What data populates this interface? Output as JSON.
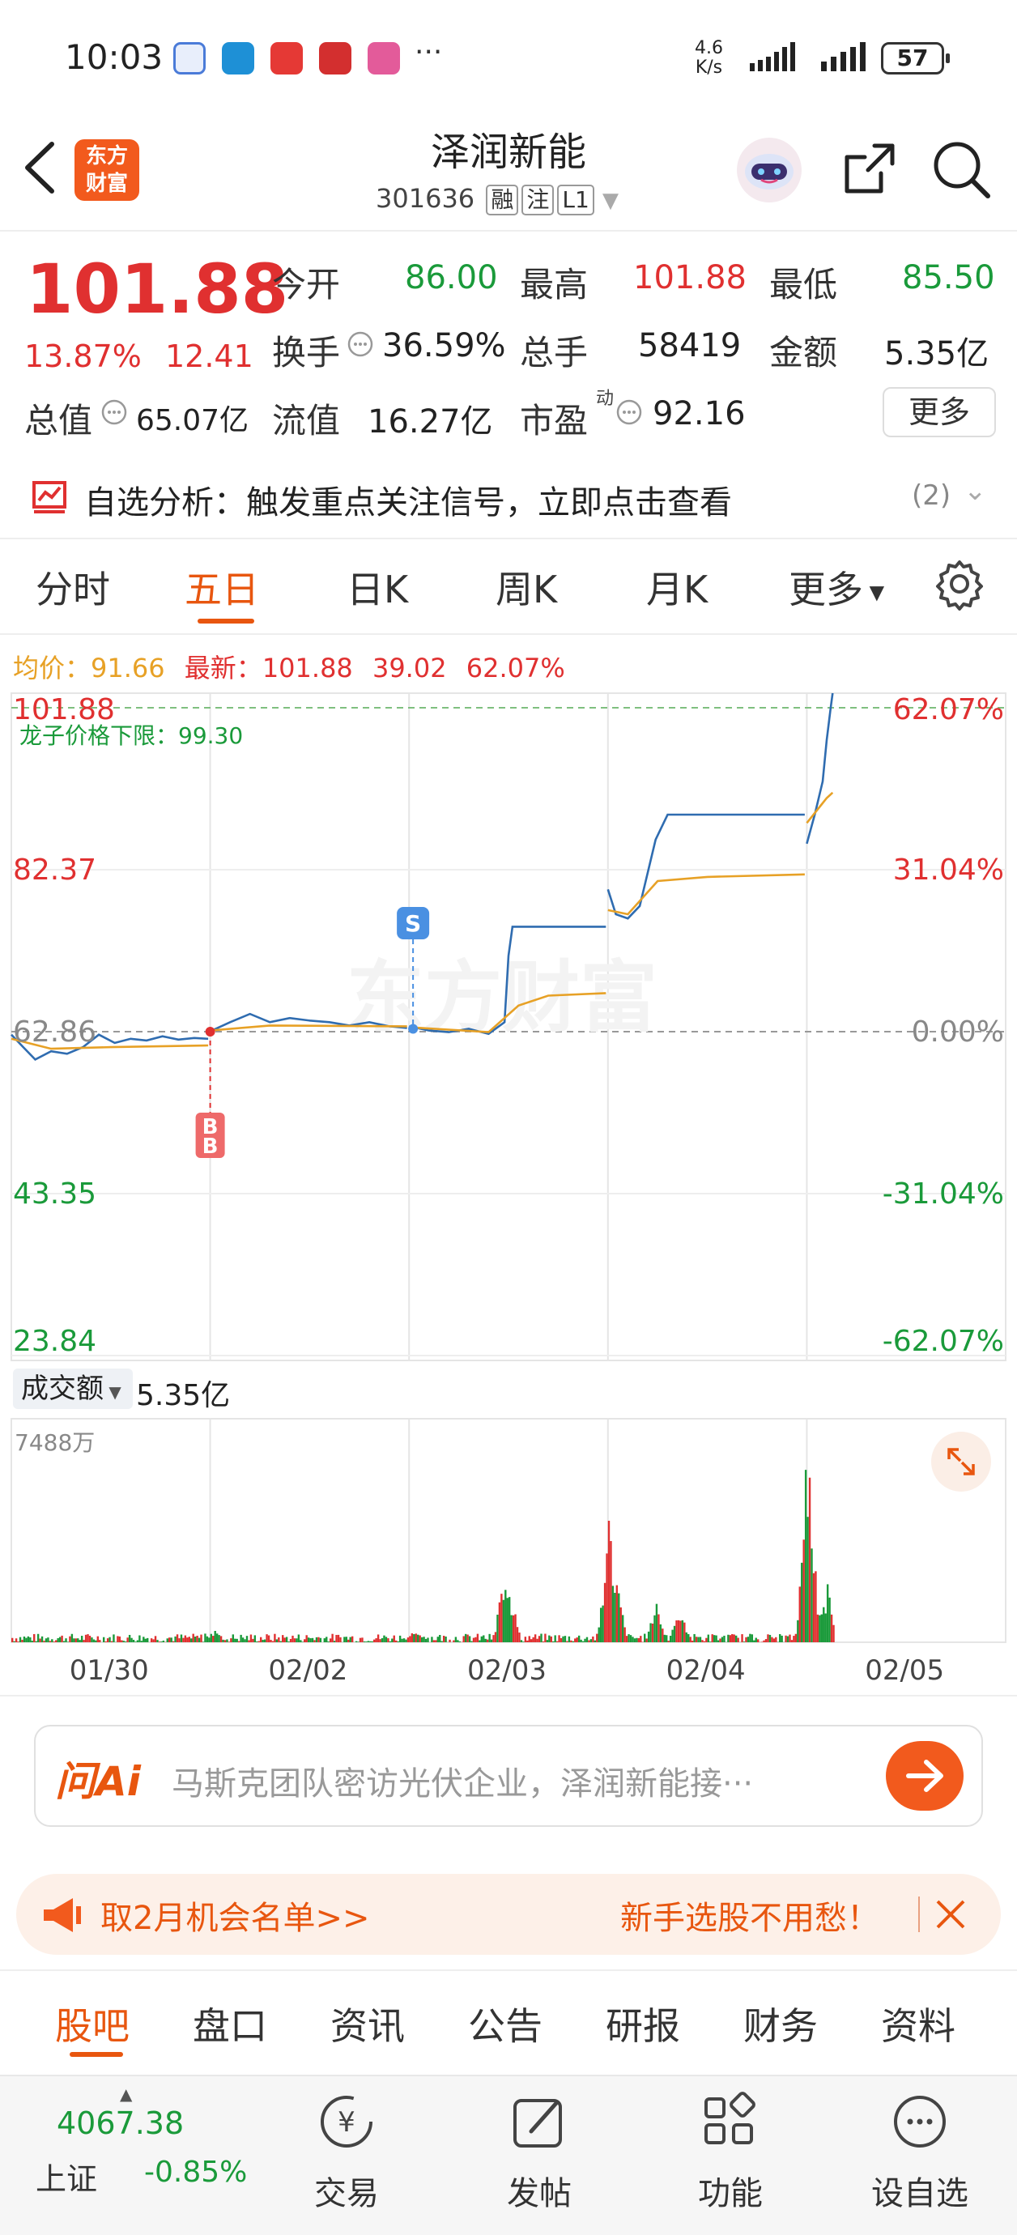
{
  "status": {
    "time": "10:03",
    "dots": "···",
    "speed_value": "4.6",
    "speed_unit": "K/s",
    "battery": "57"
  },
  "header": {
    "title": "泽润新能",
    "code": "301636",
    "tags": [
      "融",
      "注",
      "L1"
    ],
    "logo_line1": "东方",
    "logo_line2": "财富"
  },
  "quote": {
    "price": "101.88",
    "change_pct": "13.87%",
    "change_amt": "12.41",
    "open_label": "今开",
    "open": "86.00",
    "high_label": "最高",
    "high": "101.88",
    "low_label": "最低",
    "low": "85.50",
    "turnover_label": "换手",
    "turnover": "36.59%",
    "volume_label": "总手",
    "volume": "58419",
    "amount_label": "金额",
    "amount": "5.35亿",
    "mktcap_label": "总值",
    "mktcap": "65.07亿",
    "float_label": "流值",
    "float": "16.27亿",
    "pe_label": "市盈",
    "pe_sup": "动",
    "pe": "92.16",
    "more": "更多"
  },
  "analysis": {
    "label": "自选分析：触发重点关注信号，立即点击查看",
    "count": "(2)"
  },
  "tabs": [
    "分时",
    "五日",
    "日K",
    "周K",
    "月K",
    "更多"
  ],
  "active_tab": "五日",
  "chart_legend": {
    "avg_label": "均价：",
    "avg": "91.66",
    "latest_label": "最新：",
    "latest": "101.88",
    "chg": "39.02",
    "pct": "62.07%"
  },
  "chart_data": {
    "type": "line",
    "x_ticks": [
      "01/30",
      "02/02",
      "02/03",
      "02/04",
      "02/05"
    ],
    "y_left": [
      "101.88",
      "82.37",
      "62.86",
      "43.35",
      "23.84"
    ],
    "y_right": [
      "62.07%",
      "31.04%",
      "0.00%",
      "-31.04%",
      "-62.07%"
    ],
    "ylim": [
      23.84,
      101.88
    ],
    "prev_close": 62.86,
    "limit_label": "龙子价格下限：",
    "limit_value": "99.30",
    "watermark": "东方财富",
    "markers": [
      {
        "text": "B",
        "day": "02/02",
        "price": 62.86
      },
      {
        "text": "S",
        "day": "02/03",
        "price": 62.86
      }
    ],
    "series": [
      {
        "name": "price",
        "color": "#2f6cb0",
        "values": [
          [
            0.0,
            62.5
          ],
          [
            0.06,
            61.0
          ],
          [
            0.12,
            59.5
          ],
          [
            0.2,
            60.5
          ],
          [
            0.28,
            60.2
          ],
          [
            0.36,
            61.0
          ],
          [
            0.44,
            62.5
          ],
          [
            0.52,
            61.5
          ],
          [
            0.6,
            62.0
          ],
          [
            0.68,
            61.8
          ],
          [
            0.76,
            62.3
          ],
          [
            0.84,
            61.9
          ],
          [
            0.92,
            62.1
          ],
          [
            0.99,
            62.0
          ],
          [
            1.0,
            62.9
          ],
          [
            1.1,
            64.0
          ],
          [
            1.2,
            65.0
          ],
          [
            1.3,
            64.0
          ],
          [
            1.4,
            64.5
          ],
          [
            1.5,
            64.2
          ],
          [
            1.6,
            64.0
          ],
          [
            1.7,
            63.6
          ],
          [
            1.8,
            64.0
          ],
          [
            1.9,
            63.5
          ],
          [
            1.99,
            63.3
          ],
          [
            2.0,
            63.5
          ],
          [
            2.1,
            63.0
          ],
          [
            2.2,
            62.8
          ],
          [
            2.3,
            63.2
          ],
          [
            2.4,
            62.6
          ],
          [
            2.48,
            64.0
          ],
          [
            2.5,
            72.0
          ],
          [
            2.52,
            75.5
          ],
          [
            2.6,
            75.5
          ],
          [
            2.8,
            75.5
          ],
          [
            2.99,
            75.5
          ],
          [
            3.0,
            80.0
          ],
          [
            3.04,
            77.0
          ],
          [
            3.1,
            76.5
          ],
          [
            3.16,
            78.0
          ],
          [
            3.24,
            86.0
          ],
          [
            3.3,
            89.0
          ],
          [
            3.4,
            89.0
          ],
          [
            3.6,
            89.0
          ],
          [
            3.8,
            89.0
          ],
          [
            3.99,
            89.0
          ],
          [
            4.0,
            85.5
          ],
          [
            4.04,
            89.0
          ],
          [
            4.08,
            93.0
          ],
          [
            4.1,
            98.0
          ],
          [
            4.12,
            101.88
          ],
          [
            4.13,
            104.0
          ]
        ]
      },
      {
        "name": "average",
        "color": "#e7a126",
        "values": [
          [
            0.0,
            62.0
          ],
          [
            0.2,
            60.8
          ],
          [
            0.5,
            61.0
          ],
          [
            0.99,
            61.2
          ],
          [
            1.0,
            63.0
          ],
          [
            1.3,
            63.6
          ],
          [
            1.99,
            63.5
          ],
          [
            2.0,
            63.4
          ],
          [
            2.4,
            62.8
          ],
          [
            2.55,
            66.0
          ],
          [
            2.7,
            67.2
          ],
          [
            2.99,
            67.5
          ],
          [
            3.0,
            77.5
          ],
          [
            3.1,
            77.0
          ],
          [
            3.25,
            81.0
          ],
          [
            3.5,
            81.5
          ],
          [
            3.99,
            81.8
          ],
          [
            4.0,
            88.0
          ],
          [
            4.1,
            91.0
          ],
          [
            4.13,
            91.66
          ]
        ]
      }
    ],
    "volume": {
      "label": "成交额",
      "total": "5.35亿",
      "max_label": "7488万",
      "max": 7488
    }
  },
  "ai": {
    "label": "问Ai",
    "placeholder": "马斯克团队密访光伏企业，泽润新能接···"
  },
  "promo": {
    "left": "取2月机会名单>>",
    "right": "新手选股不用愁！"
  },
  "subtabs": [
    "股吧",
    "盘口",
    "资讯",
    "公告",
    "研报",
    "财务",
    "资料"
  ],
  "active_subtab": "股吧",
  "bottom": {
    "index_value": "4067.38",
    "index_name": "上证",
    "index_change": "-0.85%",
    "nav": [
      "交易",
      "发帖",
      "功能",
      "设自选"
    ]
  },
  "colors": {
    "up": "#e03030",
    "down": "#1a9a3a",
    "accent": "#e8560f",
    "price_line": "#2f6cb0",
    "avg_line": "#e7a126"
  }
}
